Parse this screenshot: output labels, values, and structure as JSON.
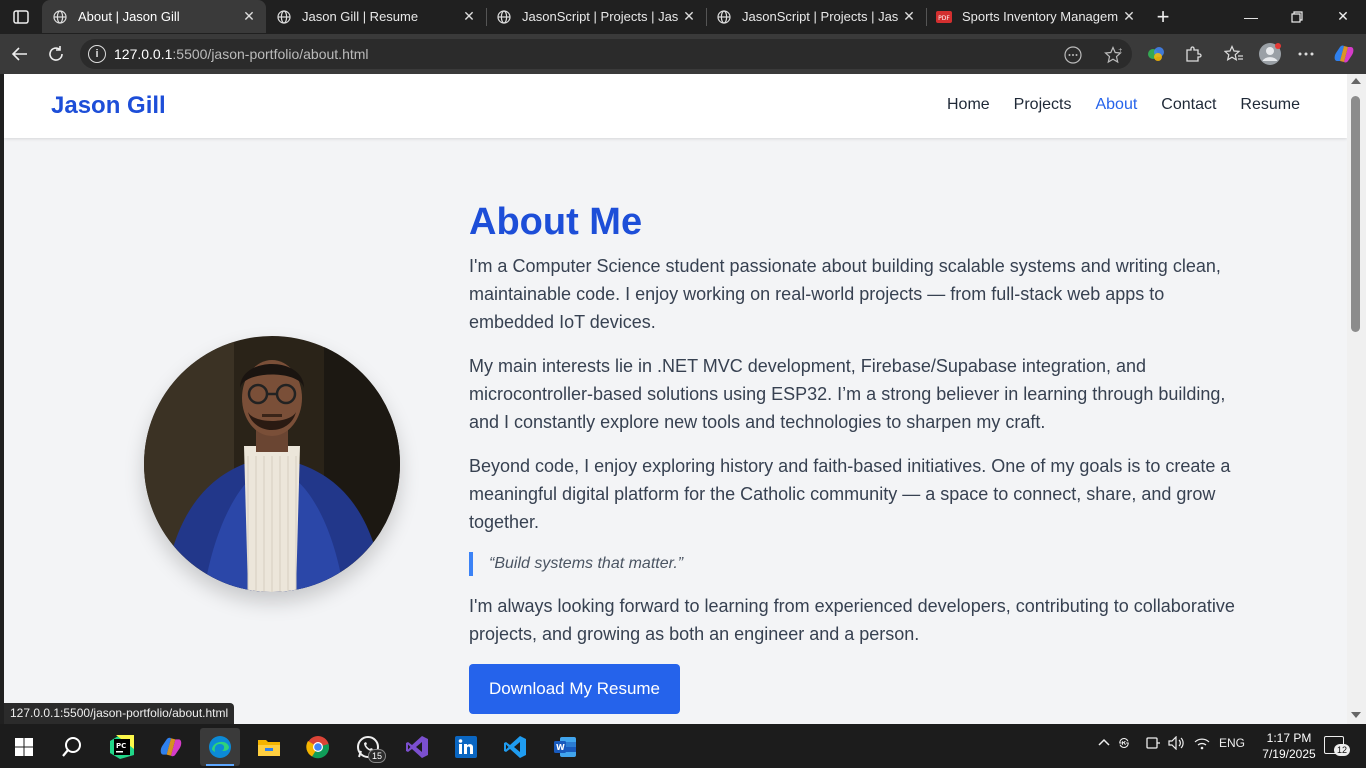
{
  "browser": {
    "tabs": [
      {
        "title": "About | Jason Gill",
        "active": true
      },
      {
        "title": "Jason Gill | Resume",
        "active": false
      },
      {
        "title": "JasonScript | Projects | Jason G",
        "active": false
      },
      {
        "title": "JasonScript | Projects | Jason G",
        "active": false
      },
      {
        "title": "Sports Inventory Management",
        "active": false
      }
    ],
    "url_host": "127.0.0.1",
    "url_rest": ":5500/jason-portfolio/about.html",
    "status_url": "127.0.0.1:5500/jason-portfolio/about.html"
  },
  "site": {
    "brand": "Jason Gill",
    "nav": [
      "Home",
      "Projects",
      "About",
      "Contact",
      "Resume"
    ],
    "active_nav": "About",
    "accent": "#2563eb",
    "heading_color": "#1d4ed8"
  },
  "about": {
    "heading": "About Me",
    "p1": "I'm a Computer Science student passionate about building scalable systems and writing clean, maintainable code. I enjoy working on real-world projects — from full-stack web apps to embedded IoT devices.",
    "p2": "My main interests lie in .NET MVC development, Firebase/Supabase integration, and microcontroller-based solutions using ESP32. I’m a strong believer in learning through building, and I constantly explore new tools and technologies to sharpen my craft.",
    "p3": "Beyond code, I enjoy exploring history and faith-based initiatives. One of my goals is to create a meaningful digital platform for the Catholic community — a space to connect, share, and grow together.",
    "quote": "“Build systems that matter.”",
    "p4": "I'm always looking forward to learning from experienced developers, contributing to collaborative projects, and growing as both an engineer and a person.",
    "button": "Download My Resume"
  },
  "taskbar": {
    "apps": [
      "start-icon",
      "search-icon",
      "pycharm-icon",
      "copilot-icon",
      "edge-icon",
      "file-explorer-icon",
      "chrome-icon",
      "whatsapp-icon",
      "visual-studio-icon",
      "linkedin-icon",
      "vscode-icon",
      "word-icon"
    ],
    "whatsapp_badge": "15",
    "language": "ENG",
    "time": "1:17 PM",
    "date": "7/19/2025",
    "notification_count": "12"
  }
}
